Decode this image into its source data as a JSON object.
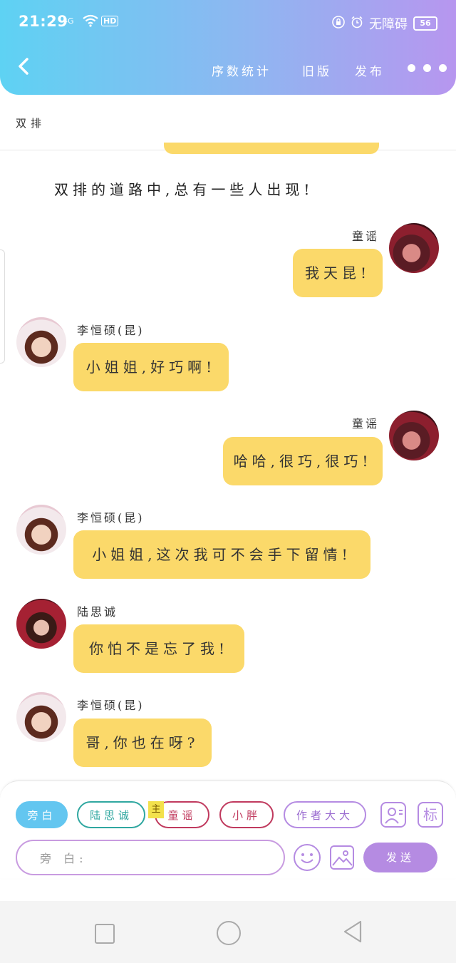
{
  "status_bar": {
    "time": "21:29",
    "signal": "4G",
    "hd": "HD",
    "accessibility": "无障碍",
    "battery": "56"
  },
  "header": {
    "nav": [
      "序数统计",
      "旧版",
      "发布"
    ]
  },
  "story": {
    "title": "双排",
    "narration": "双排的道路中,总有一些人出现!"
  },
  "messages": [
    {
      "speaker": "童谣",
      "text": "我天昆!",
      "side": "right",
      "avatar": "girl-avatar"
    },
    {
      "speaker": "李恒硕(昆)",
      "text": "小姐姐,好巧啊!",
      "side": "left",
      "avatar": "boy-avatar"
    },
    {
      "speaker": "童谣",
      "text": "哈哈,很巧,很巧!",
      "side": "right",
      "avatar": "girl-avatar"
    },
    {
      "speaker": "李恒硕(昆)",
      "text": "小姐姐,这次我可不会手下留情!",
      "side": "left",
      "avatar": "boy-avatar"
    },
    {
      "speaker": "陆思诚",
      "text": "你怕不是忘了我!",
      "side": "left",
      "avatar": "boy2-avatar"
    },
    {
      "speaker": "李恒硕(昆)",
      "text": "哥,你也在呀?",
      "side": "left",
      "avatar": "boy-avatar"
    }
  ],
  "composer": {
    "roles": [
      "旁白",
      "陆思诚",
      "童谣",
      "小胖",
      "作者大大"
    ],
    "host_tag": "主",
    "mark_label": "标",
    "input_placeholder": "旁 白:",
    "send_label": "发送"
  },
  "colors": {
    "header_gradient_start": "#5ed2f3",
    "header_gradient_end": "#b796ef",
    "bubble": "#fbd96a",
    "accent_purple": "#b58be2",
    "narration_chip": "#63c6f0"
  }
}
